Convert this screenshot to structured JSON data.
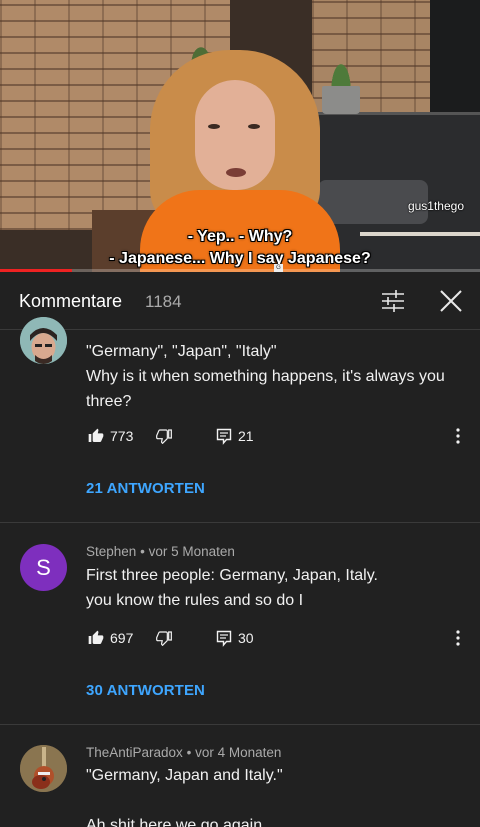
{
  "video": {
    "watermark": "gus1thego",
    "subtitle_line1": "- Yep.. - Why?",
    "subtitle_line2": "- Japanese... Why I say Japanese?",
    "progress_fraction": 0.15
  },
  "header": {
    "title": "Kommentare",
    "count": "1184",
    "filter_icon": "sliders-icon",
    "close_icon": "close-icon"
  },
  "comments": [
    {
      "author": "",
      "time": "",
      "avatar_icon": "avatar-photo-man",
      "line1": "\"Germany\", \"Japan\", \"Italy\"",
      "line2": "Why is it when something happens, it's always you",
      "line3": "three?",
      "likes": "773",
      "replies_count": "21",
      "replies_label": "21 ANTWORTEN"
    },
    {
      "author": "Stephen",
      "separator": "•",
      "time": "vor 5 Monaten",
      "avatar_letter": "S",
      "avatar_color": "#7e2fbe",
      "line1": "First three people: Germany, Japan, Italy.",
      "line2": "you know the rules and so do I",
      "likes": "697",
      "replies_count": "30",
      "replies_label": "30 ANTWORTEN"
    },
    {
      "author": "TheAntiParadox",
      "separator": "•",
      "time": "vor 4 Monaten",
      "avatar_icon": "avatar-guitar",
      "line1": "\"Germany, Japan and Italy.\"",
      "line3": "Ah shit here we go again"
    }
  ],
  "colors": {
    "background": "#212121",
    "link_blue": "#3ea6ff",
    "meta_gray": "#aaaaaa",
    "progress_red": "#ee2222"
  }
}
